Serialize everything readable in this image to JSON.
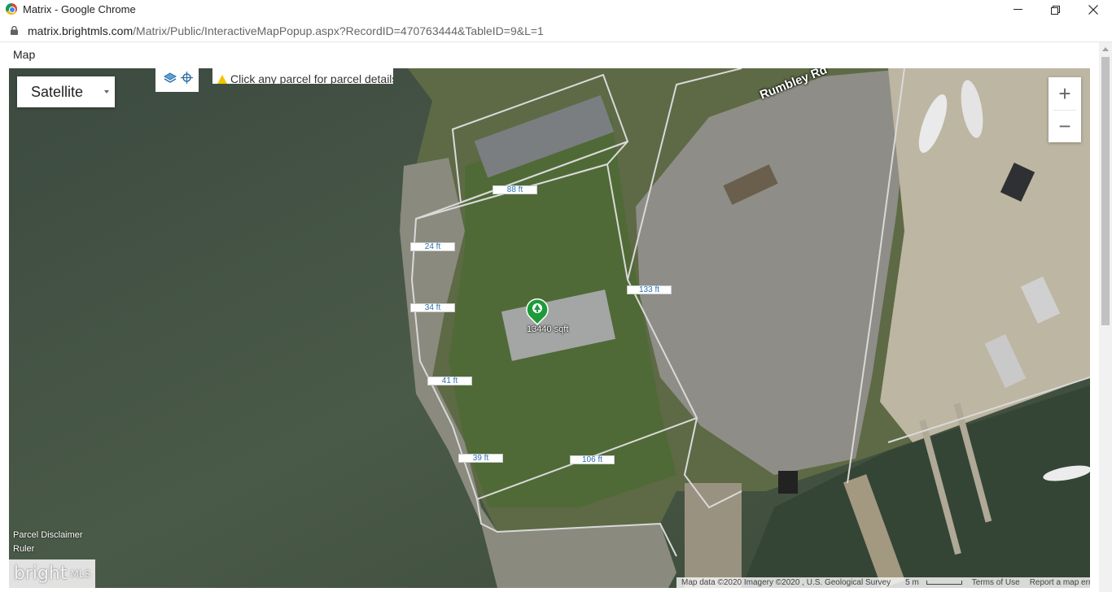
{
  "browser": {
    "window_title": "Matrix - Google Chrome",
    "url_host": "matrix.brightmls.com",
    "url_path": "/Matrix/Public/InteractiveMapPopup.aspx?RecordID=470763444&TableID=9&L=1",
    "minimize_icon": "minimize-icon",
    "restore_icon": "restore-icon",
    "close_icon": "close-icon"
  },
  "page": {
    "menu_label": "Map"
  },
  "map": {
    "map_type_selected": "Satellite",
    "hint_text": "Click any parcel for parcel details",
    "zoom_in": "+",
    "zoom_out": "−",
    "road_name": "Rumbley Rd",
    "parcel_area": "13440 sqft",
    "dimensions": [
      "88 ft",
      "24 ft",
      "34 ft",
      "133 ft",
      "41 ft",
      "39 ft",
      "106 ft"
    ],
    "links": {
      "parcel_disclaimer": "Parcel Disclaimer",
      "ruler": "Ruler"
    },
    "logo_text": "bright",
    "logo_suffix": "MLS",
    "footer": {
      "map_data": "Map data ©2020 Imagery ©2020 , U.S. Geological Survey",
      "scale": "5 m",
      "terms": "Terms of Use",
      "report": "Report a map error"
    },
    "colors": {
      "water": "#3b4d3c",
      "parcel_line": "#d9d9d9",
      "pin": "#1e9a3a"
    }
  }
}
